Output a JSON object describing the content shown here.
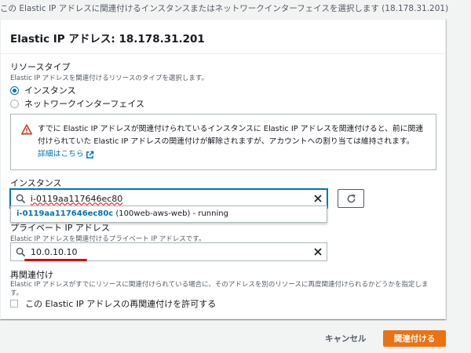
{
  "top_description": "この Elastic IP アドレスに関連付けるインスタンスまたはネットワークインターフェイスを選択します (18.178.31.201)",
  "panel": {
    "title": "Elastic IP アドレス: 18.178.31.201"
  },
  "resource_type": {
    "label": "リソースタイプ",
    "description": "Elastic IP アドレスを関連付けるリソースのタイプを選択します。",
    "options": [
      {
        "label": "インスタンス",
        "checked": true
      },
      {
        "label": "ネットワークインターフェイス",
        "checked": false
      }
    ]
  },
  "alert": {
    "line1": "すでに Elastic IP アドレスが関連付けられているインスタンスに Elastic IP アドレスを関連付けると、前に関連",
    "line2": "付けられていた Elastic IP アドレスの関連付けが解除されますが、アカウントへの割り当ては維持されます。",
    "link": "詳細はこちら",
    "icon": "warning-icon",
    "color": "#d13212"
  },
  "instance": {
    "label": "インスタンス",
    "input_value": "i-0119aa117646ec80",
    "dropdown": {
      "id": "i-0119aa117646ec80c",
      "name": " (100web-aws-web)",
      "status": " - running"
    }
  },
  "private_ip": {
    "label": "プライベート IP アドレス",
    "description": "Elastic IP アドレスを関連付けるプライベート IP アドレスです。",
    "input_value": "10.0.10.10"
  },
  "reassociation": {
    "label": "再関連付け",
    "description": "Elastic IP アドレスがすでにリソースに関連付けられている場合に、そのアドレスを別のリソースに再度関連付けられるかどうかを指定しま",
    "description2": "す。",
    "checkbox_label": "この Elastic IP アドレスの再関連付けを許可する"
  },
  "buttons": {
    "cancel": "キャンセル",
    "associate": "関連付ける"
  },
  "colors": {
    "primary": "#ec7211",
    "link": "#0073bb",
    "annotation": "#e0001a"
  }
}
